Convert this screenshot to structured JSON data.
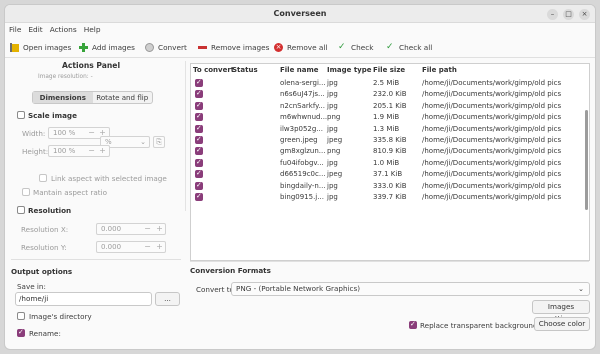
{
  "window": {
    "title": "Converseen"
  },
  "menu": [
    "File",
    "Edit",
    "Actions",
    "Help"
  ],
  "toolbar": {
    "open_images": "Open images",
    "add_images": "Add images",
    "convert": "Convert",
    "remove_images": "Remove images",
    "remove_all": "Remove all",
    "check": "Check",
    "check_all": "Check all"
  },
  "actions_panel": {
    "title": "Actions Panel",
    "image_resolution": "Image resolution:  -",
    "tabs": [
      "Dimensions",
      "Rotate and flip"
    ],
    "scale_image": "Scale image",
    "width_label": "Width:",
    "width_value": "100 %",
    "height_label": "Height:",
    "height_value": "100 %",
    "unit": "%",
    "link_aspect": "Link aspect with selected image",
    "maintain_aspect": "Mantain aspect ratio",
    "resolution": "Resolution",
    "res_x_label": "Resolution X:",
    "res_x_value": "0.000",
    "res_y_label": "Resolution Y:",
    "res_y_value": "0.000"
  },
  "output": {
    "title": "Output options",
    "save_in_label": "Save in:",
    "save_in_value": "/home/ji",
    "browse": "...",
    "images_directory": "Image's directory",
    "rename": "Rename:"
  },
  "table": {
    "headers": [
      "To convert",
      "Status",
      "File name",
      "Image type",
      "File size",
      "File path"
    ],
    "rows": [
      {
        "checked": true,
        "status": "",
        "name": "olena-sergi...",
        "type": "jpg",
        "size": "2.5 MiB",
        "path": "/home/ji/Documents/work/gimp/old pics"
      },
      {
        "checked": true,
        "status": "",
        "name": "n6s6uJ47js...",
        "type": "jpg",
        "size": "232.0 KiB",
        "path": "/home/ji/Documents/work/gimp/old pics"
      },
      {
        "checked": true,
        "status": "",
        "name": "n2cnSarkfy...",
        "type": "jpg",
        "size": "205.1 KiB",
        "path": "/home/ji/Documents/work/gimp/old pics"
      },
      {
        "checked": true,
        "status": "",
        "name": "m6whwnud...",
        "type": "png",
        "size": "1.9 MiB",
        "path": "/home/ji/Documents/work/gimp/old pics"
      },
      {
        "checked": true,
        "status": "",
        "name": "ilw3p052g...",
        "type": "jpg",
        "size": "1.3 MiB",
        "path": "/home/ji/Documents/work/gimp/old pics"
      },
      {
        "checked": true,
        "status": "",
        "name": "green.jpeg",
        "type": "jpeg",
        "size": "335.8 KiB",
        "path": "/home/ji/Documents/work/gimp/old pics"
      },
      {
        "checked": true,
        "status": "",
        "name": "gm8xglzun...",
        "type": "png",
        "size": "810.9 KiB",
        "path": "/home/ji/Documents/work/gimp/old pics"
      },
      {
        "checked": true,
        "status": "",
        "name": "fu04ifobgv...",
        "type": "jpg",
        "size": "1.0 MiB",
        "path": "/home/ji/Documents/work/gimp/old pics"
      },
      {
        "checked": true,
        "status": "",
        "name": "d66519c0c...",
        "type": "jpeg",
        "size": "37.1 KiB",
        "path": "/home/ji/Documents/work/gimp/old pics"
      },
      {
        "checked": true,
        "status": "",
        "name": "bingdaily-n...",
        "type": "jpg",
        "size": "333.0 KiB",
        "path": "/home/ji/Documents/work/gimp/old pics"
      },
      {
        "checked": true,
        "status": "",
        "name": "bing0915.j...",
        "type": "jpg",
        "size": "339.7 KiB",
        "path": "/home/ji/Documents/work/gimp/old pics"
      }
    ]
  },
  "conversion": {
    "title": "Conversion Formats",
    "convert_to_label": "Convert to:",
    "format": "PNG - (Portable Network Graphics)",
    "images_settings": "Images settings",
    "replace_bg": "Replace transparent background",
    "choose_color": "Choose color"
  }
}
